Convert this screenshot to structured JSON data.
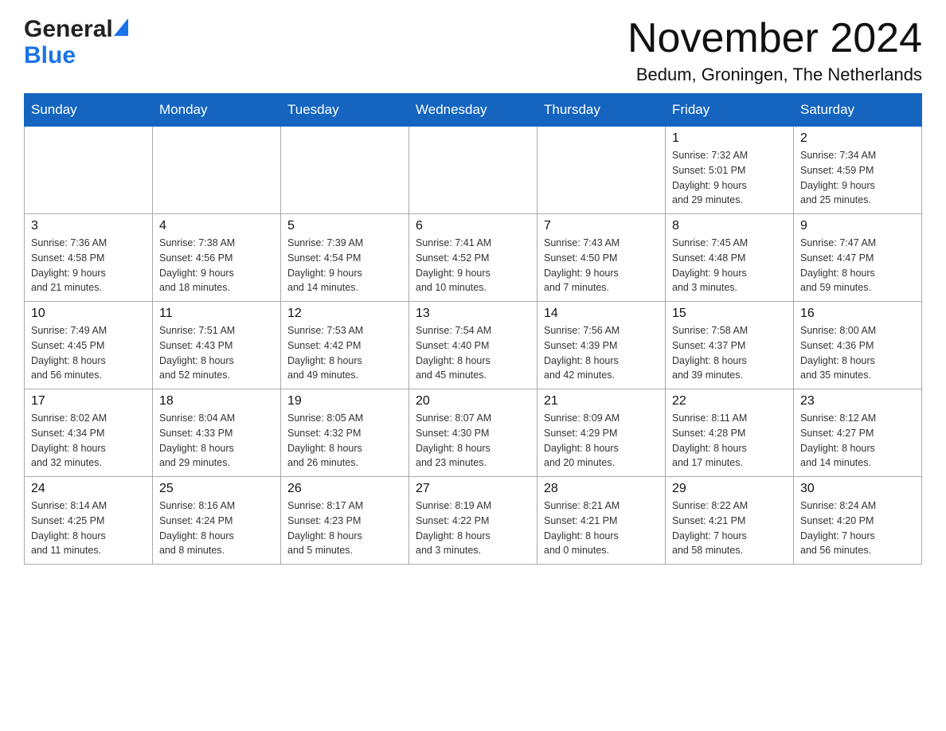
{
  "header": {
    "logo_general": "General",
    "logo_blue": "Blue",
    "month_title": "November 2024",
    "location": "Bedum, Groningen, The Netherlands"
  },
  "days_of_week": [
    "Sunday",
    "Monday",
    "Tuesday",
    "Wednesday",
    "Thursday",
    "Friday",
    "Saturday"
  ],
  "weeks": [
    [
      {
        "day": "",
        "info": ""
      },
      {
        "day": "",
        "info": ""
      },
      {
        "day": "",
        "info": ""
      },
      {
        "day": "",
        "info": ""
      },
      {
        "day": "",
        "info": ""
      },
      {
        "day": "1",
        "info": "Sunrise: 7:32 AM\nSunset: 5:01 PM\nDaylight: 9 hours\nand 29 minutes."
      },
      {
        "day": "2",
        "info": "Sunrise: 7:34 AM\nSunset: 4:59 PM\nDaylight: 9 hours\nand 25 minutes."
      }
    ],
    [
      {
        "day": "3",
        "info": "Sunrise: 7:36 AM\nSunset: 4:58 PM\nDaylight: 9 hours\nand 21 minutes."
      },
      {
        "day": "4",
        "info": "Sunrise: 7:38 AM\nSunset: 4:56 PM\nDaylight: 9 hours\nand 18 minutes."
      },
      {
        "day": "5",
        "info": "Sunrise: 7:39 AM\nSunset: 4:54 PM\nDaylight: 9 hours\nand 14 minutes."
      },
      {
        "day": "6",
        "info": "Sunrise: 7:41 AM\nSunset: 4:52 PM\nDaylight: 9 hours\nand 10 minutes."
      },
      {
        "day": "7",
        "info": "Sunrise: 7:43 AM\nSunset: 4:50 PM\nDaylight: 9 hours\nand 7 minutes."
      },
      {
        "day": "8",
        "info": "Sunrise: 7:45 AM\nSunset: 4:48 PM\nDaylight: 9 hours\nand 3 minutes."
      },
      {
        "day": "9",
        "info": "Sunrise: 7:47 AM\nSunset: 4:47 PM\nDaylight: 8 hours\nand 59 minutes."
      }
    ],
    [
      {
        "day": "10",
        "info": "Sunrise: 7:49 AM\nSunset: 4:45 PM\nDaylight: 8 hours\nand 56 minutes."
      },
      {
        "day": "11",
        "info": "Sunrise: 7:51 AM\nSunset: 4:43 PM\nDaylight: 8 hours\nand 52 minutes."
      },
      {
        "day": "12",
        "info": "Sunrise: 7:53 AM\nSunset: 4:42 PM\nDaylight: 8 hours\nand 49 minutes."
      },
      {
        "day": "13",
        "info": "Sunrise: 7:54 AM\nSunset: 4:40 PM\nDaylight: 8 hours\nand 45 minutes."
      },
      {
        "day": "14",
        "info": "Sunrise: 7:56 AM\nSunset: 4:39 PM\nDaylight: 8 hours\nand 42 minutes."
      },
      {
        "day": "15",
        "info": "Sunrise: 7:58 AM\nSunset: 4:37 PM\nDaylight: 8 hours\nand 39 minutes."
      },
      {
        "day": "16",
        "info": "Sunrise: 8:00 AM\nSunset: 4:36 PM\nDaylight: 8 hours\nand 35 minutes."
      }
    ],
    [
      {
        "day": "17",
        "info": "Sunrise: 8:02 AM\nSunset: 4:34 PM\nDaylight: 8 hours\nand 32 minutes."
      },
      {
        "day": "18",
        "info": "Sunrise: 8:04 AM\nSunset: 4:33 PM\nDaylight: 8 hours\nand 29 minutes."
      },
      {
        "day": "19",
        "info": "Sunrise: 8:05 AM\nSunset: 4:32 PM\nDaylight: 8 hours\nand 26 minutes."
      },
      {
        "day": "20",
        "info": "Sunrise: 8:07 AM\nSunset: 4:30 PM\nDaylight: 8 hours\nand 23 minutes."
      },
      {
        "day": "21",
        "info": "Sunrise: 8:09 AM\nSunset: 4:29 PM\nDaylight: 8 hours\nand 20 minutes."
      },
      {
        "day": "22",
        "info": "Sunrise: 8:11 AM\nSunset: 4:28 PM\nDaylight: 8 hours\nand 17 minutes."
      },
      {
        "day": "23",
        "info": "Sunrise: 8:12 AM\nSunset: 4:27 PM\nDaylight: 8 hours\nand 14 minutes."
      }
    ],
    [
      {
        "day": "24",
        "info": "Sunrise: 8:14 AM\nSunset: 4:25 PM\nDaylight: 8 hours\nand 11 minutes."
      },
      {
        "day": "25",
        "info": "Sunrise: 8:16 AM\nSunset: 4:24 PM\nDaylight: 8 hours\nand 8 minutes."
      },
      {
        "day": "26",
        "info": "Sunrise: 8:17 AM\nSunset: 4:23 PM\nDaylight: 8 hours\nand 5 minutes."
      },
      {
        "day": "27",
        "info": "Sunrise: 8:19 AM\nSunset: 4:22 PM\nDaylight: 8 hours\nand 3 minutes."
      },
      {
        "day": "28",
        "info": "Sunrise: 8:21 AM\nSunset: 4:21 PM\nDaylight: 8 hours\nand 0 minutes."
      },
      {
        "day": "29",
        "info": "Sunrise: 8:22 AM\nSunset: 4:21 PM\nDaylight: 7 hours\nand 58 minutes."
      },
      {
        "day": "30",
        "info": "Sunrise: 8:24 AM\nSunset: 4:20 PM\nDaylight: 7 hours\nand 56 minutes."
      }
    ]
  ]
}
